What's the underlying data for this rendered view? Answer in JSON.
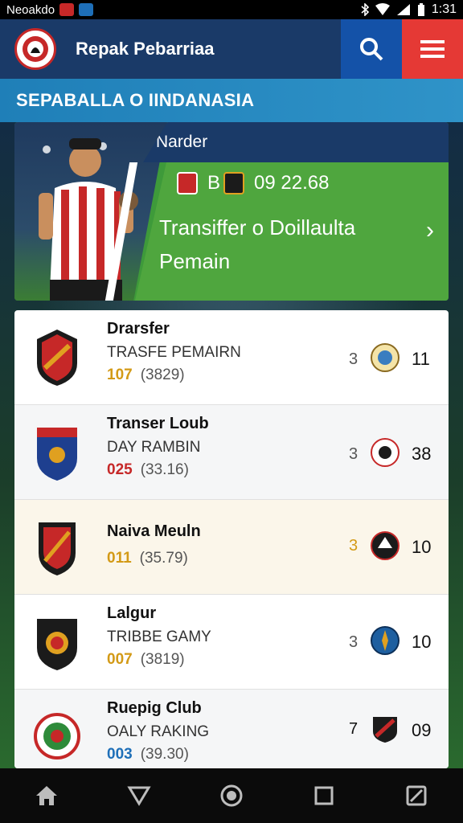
{
  "status": {
    "carrier": "Neoakdo",
    "time": "1:31"
  },
  "header": {
    "title": "Repak Pebarriaa"
  },
  "section": {
    "title": "SEPABALLA O IINDANASIA"
  },
  "feature": {
    "tag": "Narder",
    "score_prefix": "B",
    "score": "09 22.68",
    "headline_line1": "Transiffer o Doillaulta",
    "headline_line2": "Pemain"
  },
  "list": [
    {
      "title": "Drarsfer",
      "subtitle": "TRASFE PEMAIRN",
      "num_a": "107",
      "num_b": "(3829)",
      "small": "3",
      "right": "11",
      "num_color": "#d39a16"
    },
    {
      "title": "Transer Loub",
      "subtitle": "DAY RAMBIN",
      "num_a": "025",
      "num_b": "(33.16)",
      "small": "3",
      "right": "38",
      "num_color": "#c62828"
    },
    {
      "title": "Naiva Meuln",
      "subtitle": "",
      "num_a": "011",
      "num_b": "(35.79)",
      "small": "3",
      "right": "10",
      "num_color": "#d39a16"
    },
    {
      "title": "Lalgur",
      "subtitle": "TRIBBE GAMY",
      "num_a": "007",
      "num_b": "(3819)",
      "small": "3",
      "right": "10",
      "num_color": "#d39a16"
    },
    {
      "title": "Ruepig Club",
      "subtitle": "OALY RAKING",
      "num_a": "003",
      "num_b": "(39.30)",
      "small": "7",
      "right": "09",
      "num_color": "#1e6fb8"
    }
  ],
  "colors": {
    "header_bg": "#1a3a68",
    "search_bg": "#1452a8",
    "menu_bg": "#e53935",
    "section_bg": "#2f93c8",
    "feature_green": "#4fa63e"
  }
}
